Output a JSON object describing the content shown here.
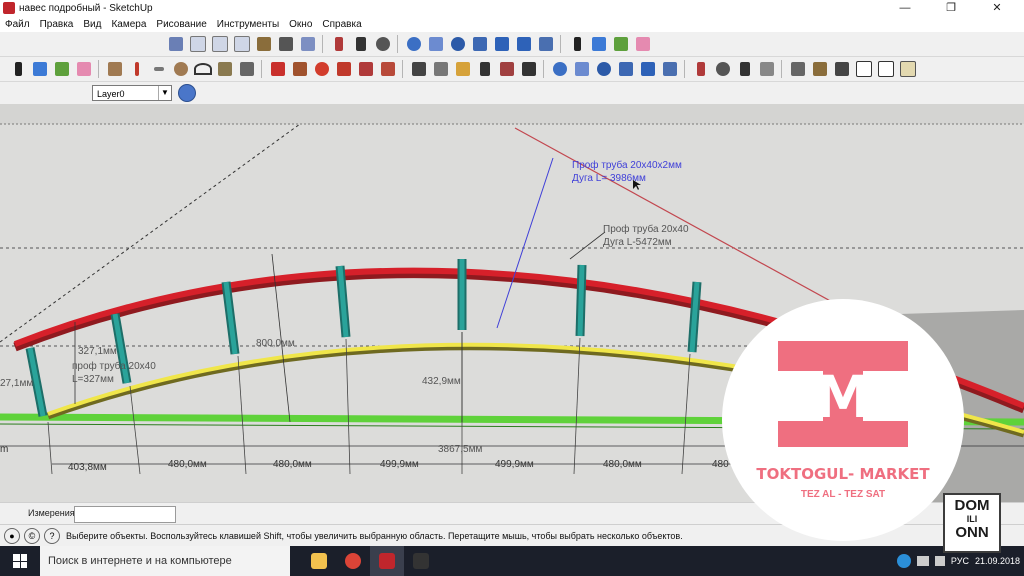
{
  "window": {
    "title": "навес подробный - SketchUp",
    "controls": [
      "—",
      "❐",
      "✕"
    ]
  },
  "menu": [
    "Файл",
    "Правка",
    "Вид",
    "Камера",
    "Рисование",
    "Инструменты",
    "Окно",
    "Справка"
  ],
  "layers": {
    "current": "Layer0"
  },
  "annotations": {
    "arc_pipe": [
      "Проф труба 20x40x2мм",
      "Дуга L= 3986мм"
    ],
    "top_pipe": [
      "Проф труба 20x40",
      "Дуга L-5472мм"
    ],
    "left_pipe": [
      "проф труба 20x40",
      "L=327мм"
    ],
    "post_height_left": "327,1мм",
    "post_height_edge": "27,1мм",
    "rise_outer": "800,0мм",
    "rise_inner": "432,9мм",
    "span_total": "3867,5мм",
    "spacings": [
      "403,8мм",
      "480,0мм",
      "480,0мм",
      "499,9мм",
      "499,9мм",
      "480,0мм",
      "480"
    ],
    "edge_mark": "m"
  },
  "measurements": {
    "label": "Измерения",
    "value": ""
  },
  "status": {
    "hint": "Выберите объекты. Воспользуйтесь клавишей Shift, чтобы увеличить выбранную область. Перетащите мышь, чтобы выбрать несколько объектов."
  },
  "taskbar": {
    "search_placeholder": "Поиск в интернете и на компьютере",
    "lang": "РУС",
    "date": "21.09.2018"
  },
  "overlay_logo": {
    "brand": "TOKTOGUL- MARKET",
    "slogan": "TEZ AL - TEZ SAT",
    "letter": "M",
    "color": "#ef6f80"
  },
  "watermark": {
    "line1": "DOM",
    "line2": "ILI",
    "line3": "ONN"
  },
  "colors": {
    "top_arc": "#d6202a",
    "inner_arc": "#f0e64a",
    "posts": "#2aa39a",
    "base_line": "#5fd23a",
    "leader": "#3f3fd8",
    "guide_red": "#c2474f"
  }
}
